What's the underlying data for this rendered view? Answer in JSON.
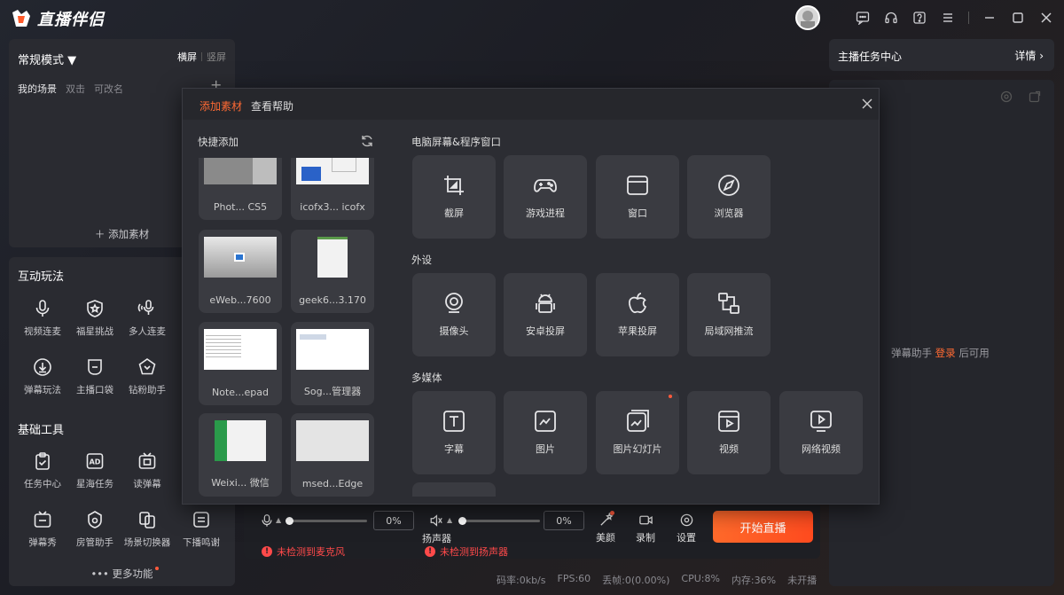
{
  "app": {
    "title": "直播伴侣"
  },
  "window_controls": [
    "chat-icon",
    "headset-icon",
    "help-icon",
    "menu-icon",
    "minimize-icon",
    "maximize-icon",
    "close-icon"
  ],
  "scene_panel": {
    "mode_label": "常规模式 ▼",
    "orientation_landscape": "横屏",
    "orientation_portrait": "竖屏",
    "my_scene": "我的场景",
    "hint_double_click": "双击",
    "hint_rename": "可改名",
    "add_material": "＋ 添加素材"
  },
  "interactive": {
    "title": "互动玩法",
    "items": [
      {
        "label": "视频连麦",
        "icon": "mic-icon"
      },
      {
        "label": "福星挑战",
        "icon": "star-shield-icon"
      },
      {
        "label": "多人连麦",
        "icon": "multi-mic-icon"
      },
      {
        "label": "弹幕玩法",
        "icon": "download-circle-icon"
      },
      {
        "label": "主播口袋",
        "icon": "pocket-icon"
      },
      {
        "label": "钻粉助手",
        "icon": "diamond-icon"
      }
    ]
  },
  "basic_tools": {
    "title": "基础工具",
    "items": [
      {
        "label": "任务中心",
        "icon": "clipboard-icon"
      },
      {
        "label": "星海任务",
        "icon": "ad-icon"
      },
      {
        "label": "读弹幕",
        "icon": "tv-icon"
      },
      {
        "label": "弹幕秀",
        "icon": "tv-show-icon"
      },
      {
        "label": "房管助手",
        "icon": "shield-icon"
      },
      {
        "label": "场景切换器",
        "icon": "switch-icon"
      },
      {
        "label": "下播鸣谢",
        "icon": "thanks-icon"
      }
    ],
    "more": "••• 更多功能"
  },
  "task_center": {
    "title": "主播任务中心",
    "detail": "详情 ›"
  },
  "danmu": {
    "hint_prefix": "弹幕助手",
    "login": "登录",
    "hint_suffix": "后可用"
  },
  "bottom_bar": {
    "mic_pct": "0%",
    "speaker_pct": "0%",
    "speaker_label": "扬声器",
    "mic_warning": "未检测到麦克风",
    "speaker_warning": "未检测到扬声器",
    "beauty": "美颜",
    "record": "录制",
    "settings": "设置",
    "start": "开始直播"
  },
  "status": {
    "bitrate": "码率:0kb/s",
    "fps": "FPS:60",
    "dropped": "丢帧:0(0.00%)",
    "cpu": "CPU:8%",
    "memory": "内存:36%",
    "live": "未开播"
  },
  "modal": {
    "tab_add": "添加素材",
    "tab_help": "查看帮助",
    "quick_add_title": "快捷添加",
    "windows": [
      {
        "label": "Phot... CS5"
      },
      {
        "label": "icofx3... icofx"
      },
      {
        "label": "eWeb...7600"
      },
      {
        "label": "geek6...3.170"
      },
      {
        "label": "Note...epad"
      },
      {
        "label": "Sog...管理器"
      },
      {
        "label": "Weixi... 微信"
      },
      {
        "label": "msed...Edge"
      }
    ],
    "cat_screen": "电脑屏幕&程序窗口",
    "screen_items": [
      {
        "label": "截屏",
        "icon": "crop-icon"
      },
      {
        "label": "游戏进程",
        "icon": "gamepad-icon"
      },
      {
        "label": "窗口",
        "icon": "window-icon"
      },
      {
        "label": "浏览器",
        "icon": "compass-icon"
      }
    ],
    "cat_device": "外设",
    "device_items": [
      {
        "label": "摄像头",
        "icon": "webcam-icon"
      },
      {
        "label": "安卓投屏",
        "icon": "android-icon"
      },
      {
        "label": "苹果投屏",
        "icon": "apple-icon"
      },
      {
        "label": "局域网推流",
        "icon": "lan-icon"
      }
    ],
    "cat_media": "多媒体",
    "media_items": [
      {
        "label": "字幕",
        "icon": "text-icon"
      },
      {
        "label": "图片",
        "icon": "image-icon"
      },
      {
        "label": "图片幻灯片",
        "icon": "slideshow-icon"
      },
      {
        "label": "视频",
        "icon": "video-icon"
      },
      {
        "label": "网络视频",
        "icon": "web-video-icon"
      }
    ]
  },
  "colors": {
    "accent": "#ff6a33",
    "warning": "#ff4a4a",
    "panel": "#2a2b31"
  }
}
